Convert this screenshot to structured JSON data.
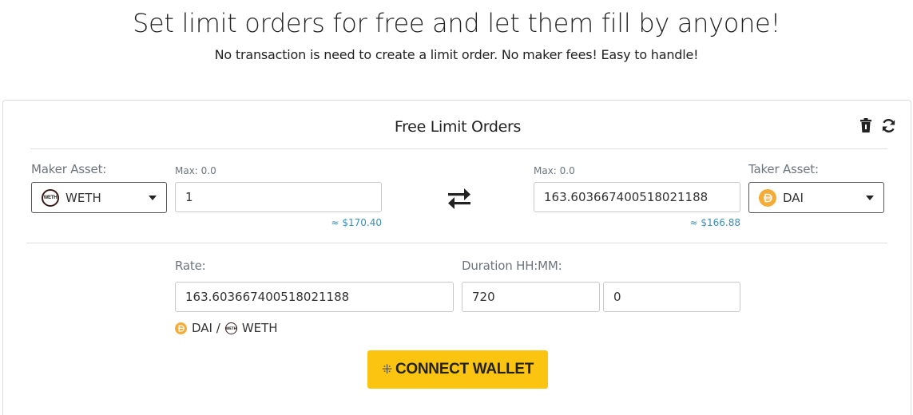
{
  "hero": {
    "title": "Set limit orders for free and let them fill by anyone!",
    "subtitle": "No transaction is need to create a limit order. No maker fees! Easy to handle!"
  },
  "card": {
    "title": "Free Limit Orders",
    "icons": {
      "trash": "trash-icon",
      "refresh": "refresh-icon"
    }
  },
  "maker": {
    "label": "Maker Asset:",
    "token": "WETH",
    "token_badge_text": "WETH",
    "max_label": "Max: 0.0",
    "amount": "1",
    "usd": "≈ $170.40"
  },
  "taker": {
    "label": "Taker Asset:",
    "token": "DAI",
    "max_label": "Max: 0.0",
    "amount": "163.603667400518021188",
    "usd": "≈ $166.88"
  },
  "rate": {
    "label": "Rate:",
    "value": "163.603667400518021188",
    "pair_base": "DAI",
    "pair_sep": " / ",
    "pair_quote": "WETH"
  },
  "duration": {
    "label": "Duration HH:MM:",
    "hours": "720",
    "minutes": "0"
  },
  "connect": {
    "label": "CONNECT WALLET"
  },
  "colors": {
    "accent": "#fbc410",
    "usd_text": "#3a8fb5",
    "dai": "#f5ac37"
  }
}
